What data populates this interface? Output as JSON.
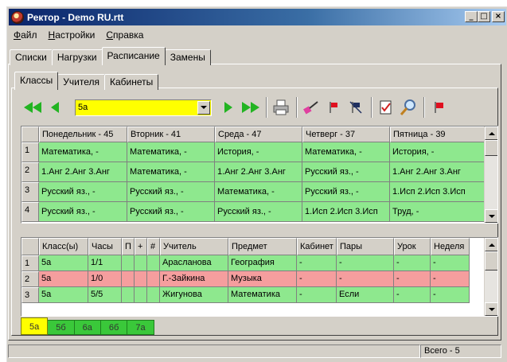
{
  "window": {
    "title": "Ректор - Demo RU.rtt",
    "minimize": "_",
    "maximize": "□",
    "close": "×"
  },
  "menu": [
    {
      "hot": "Ф",
      "rest": "айл"
    },
    {
      "hot": "Н",
      "rest": "астройки"
    },
    {
      "hot": "С",
      "rest": "правка"
    }
  ],
  "outer_tabs": [
    "Списки",
    "Нагрузки",
    "Расписание",
    "Замены"
  ],
  "inner_tabs": [
    "Классы",
    "Учителя",
    "Кабинеты"
  ],
  "toolbar": {
    "class_value": "5а"
  },
  "schedule": {
    "headers": [
      "Понедельник - 45",
      "Вторник - 41",
      "Среда - 47",
      "Четверг - 37",
      "Пятница - 39"
    ],
    "rows": [
      {
        "n": "1",
        "cells": [
          "Математика, -",
          "Математика, -",
          "История, -",
          "Математика, -",
          "История, -"
        ]
      },
      {
        "n": "2",
        "cells": [
          "1.Анг 2.Анг 3.Анг",
          "Математика, -",
          "1.Анг 2.Анг 3.Анг",
          "Русский яз., -",
          "1.Анг 2.Анг 3.Анг"
        ]
      },
      {
        "n": "3",
        "cells": [
          "Русский яз., -",
          "Русский яз., -",
          "Математика, -",
          "Русский яз., -",
          "1.Исп 2.Исп 3.Исп"
        ]
      },
      {
        "n": "4",
        "cells": [
          "Русский яз., -",
          "Русский яз., -",
          "Русский яз., -",
          "1.Исп 2.Исп 3.Исп",
          "Труд, -"
        ]
      }
    ]
  },
  "lessons": {
    "headers": [
      "Класс(ы)",
      "Часы",
      "П",
      "+",
      "#",
      "Учитель",
      "Предмет",
      "Кабинет",
      "Пары",
      "Урок",
      "Неделя"
    ],
    "rows": [
      {
        "n": "1",
        "color": "green",
        "cells": [
          "5а",
          "1/1",
          "",
          "",
          "",
          "Арасланова",
          "География",
          "-",
          "-",
          "-",
          "-"
        ]
      },
      {
        "n": "2",
        "color": "red",
        "cells": [
          "5а",
          "1/0",
          "",
          "",
          "",
          "Г.-Зайкина",
          "Музыка",
          "-",
          "-",
          "-",
          "-"
        ]
      },
      {
        "n": "3",
        "color": "green",
        "cells": [
          "5а",
          "5/5",
          "",
          "",
          "",
          "Жигунова",
          "Математика",
          "-",
          "Если",
          "-",
          "-"
        ]
      }
    ]
  },
  "class_tabs": [
    "5а",
    "5б",
    "6а",
    "6б",
    "7а"
  ],
  "status": {
    "total": "Всего - 5"
  },
  "colors": {
    "green": "#8ee88e",
    "red": "#f59e9e",
    "highlight": "#ffff00"
  }
}
